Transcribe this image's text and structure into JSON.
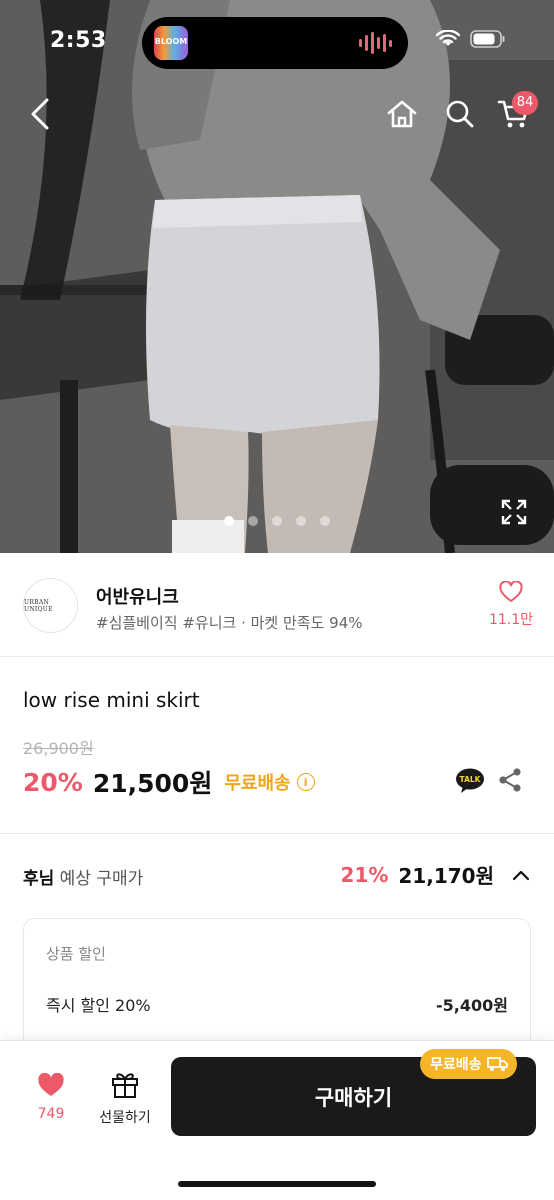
{
  "status_bar": {
    "time": "2:53",
    "island_app_label": "BLOOM"
  },
  "nav": {
    "back_icon": "chevron-left-icon",
    "home_icon": "home-icon",
    "search_icon": "search-icon",
    "cart_icon": "cart-icon",
    "cart_badge": "84"
  },
  "gallery": {
    "image_count": 5,
    "active_index": 0,
    "fullscreen_icon": "expand-icon"
  },
  "seller": {
    "logo_text": "URBAN UNIQUE",
    "name": "어반유니크",
    "tags": "#심플베이직 #유니크 · 마켓 만족도 94%",
    "like_count": "11.1만"
  },
  "product": {
    "title": "low rise mini skirt",
    "original_price": "26,900원",
    "discount": "20%",
    "sale_price": "21,500원",
    "shipping": "무료배송",
    "info_icon": "i"
  },
  "expected": {
    "user": "후님",
    "label": " 예상 구매가",
    "discount": "21%",
    "price": "21,170원"
  },
  "detail": {
    "heading": "상품 할인",
    "rows": [
      {
        "label": "즉시 할인 20%",
        "value": "-5,400원"
      }
    ]
  },
  "bottom": {
    "wish_count": "749",
    "gift_label": "선물하기",
    "buy_label": "구매하기",
    "ship_tag": "무료배송"
  },
  "colors": {
    "accent_red": "#ec5a6a",
    "accent_orange": "#f2a516",
    "button_dark": "#1a1a1a"
  }
}
